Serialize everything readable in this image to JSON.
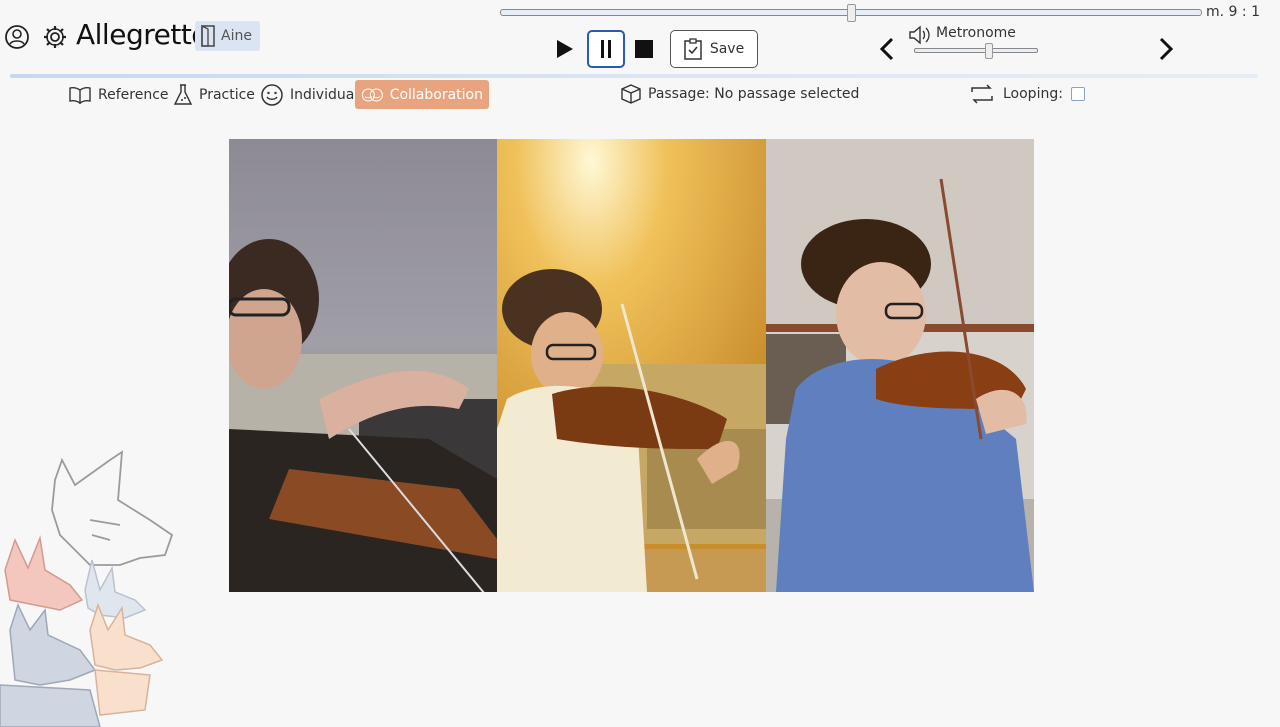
{
  "app": {
    "title": "Allegretto",
    "user": "Aine"
  },
  "playback": {
    "measure_label": "m. 9 : 1",
    "progress": 0.5,
    "save_label": "Save"
  },
  "metronome": {
    "label": "Metronome",
    "level": 0.6
  },
  "modes": [
    {
      "label": "Reference",
      "active": false
    },
    {
      "label": "Practice",
      "active": false
    },
    {
      "label": "Individual",
      "active": false
    },
    {
      "label": "Collaboration",
      "active": true
    }
  ],
  "passage": {
    "label": "Passage: No passage selected"
  },
  "looping": {
    "label": "Looping:",
    "checked": false
  },
  "colors": {
    "accent": "#e8a47e",
    "focus": "#2a5bb0",
    "divider": "#c7d7ee"
  },
  "icons": [
    "user-icon",
    "gear-icon",
    "exit-icon",
    "play-icon",
    "pause-icon",
    "stop-icon",
    "clipboard-check-icon",
    "chevron-left-icon",
    "chevron-right-icon",
    "speaker-icon",
    "book-icon",
    "flask-icon",
    "smiley-icon",
    "two-faces-icon",
    "box-icon",
    "loop-icon"
  ]
}
